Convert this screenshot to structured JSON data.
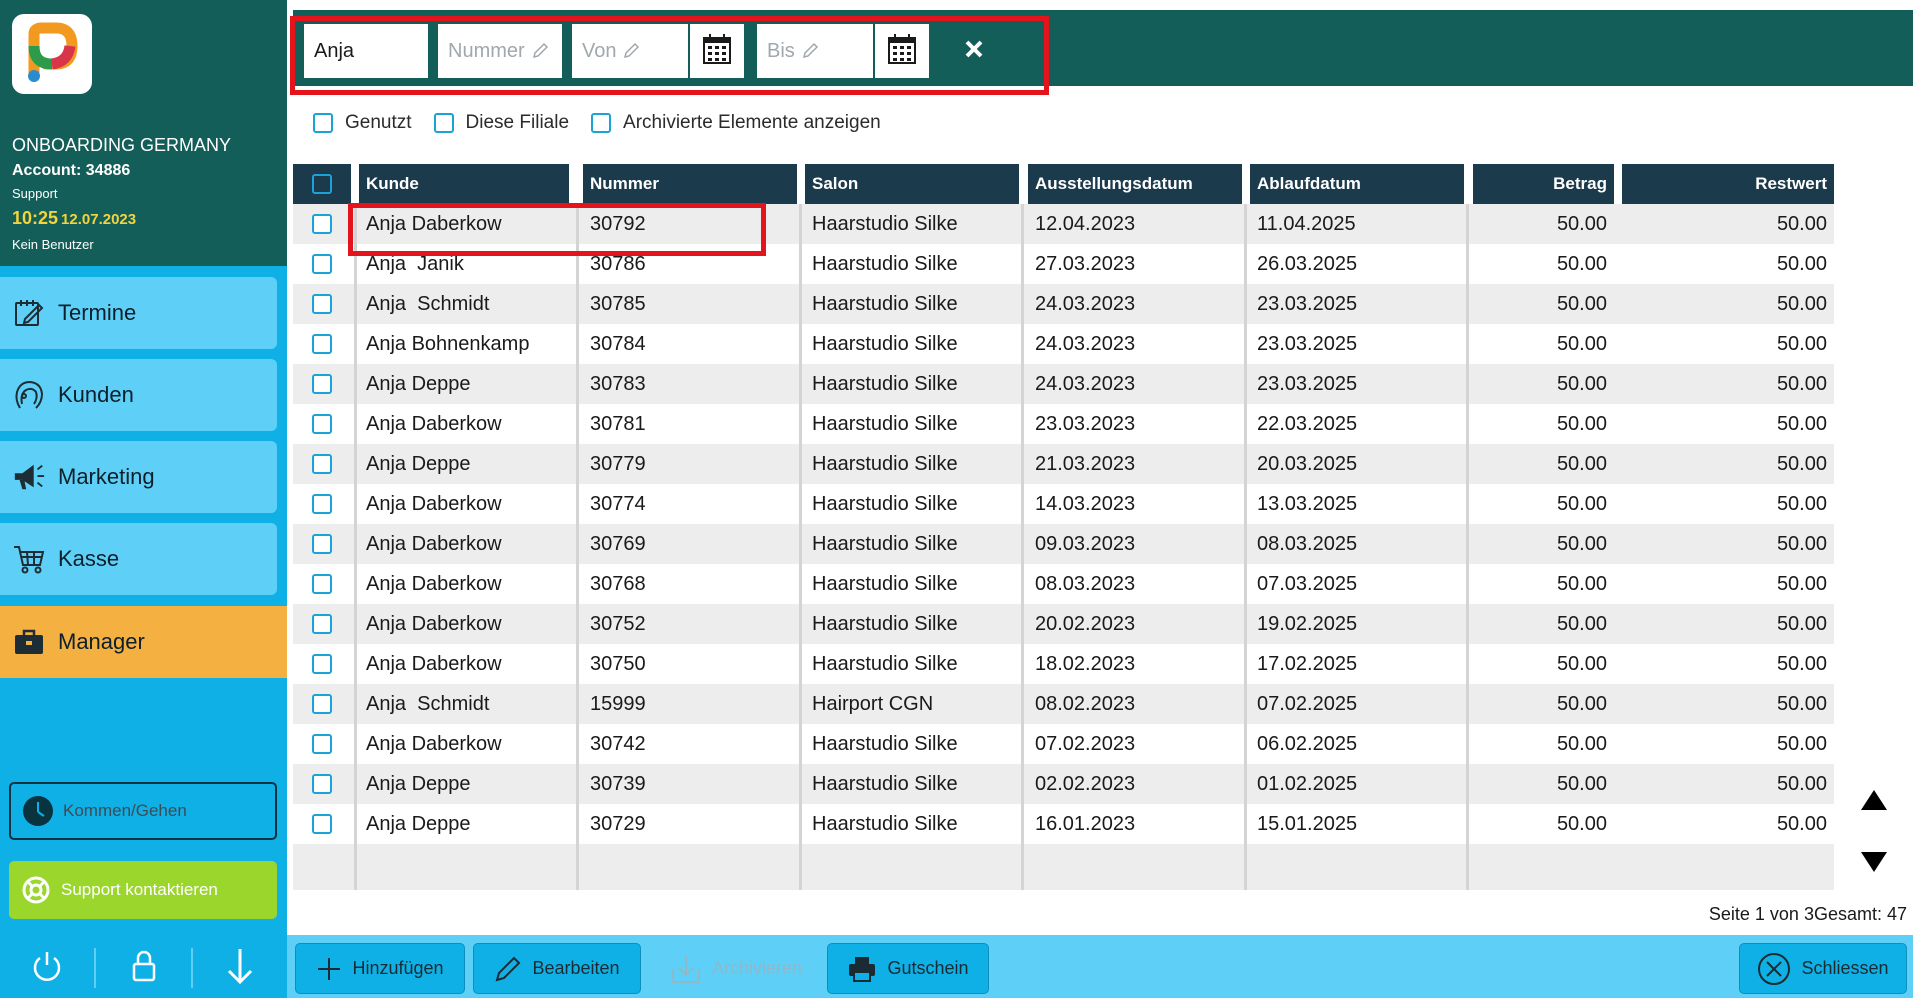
{
  "account": {
    "company": "ONBOARDING GERMANY",
    "number": "Account: 34886",
    "role": "Support",
    "time": "10:25",
    "date": "12.07.2023",
    "user": "Kein Benutzer"
  },
  "nav": [
    {
      "label": "Termine",
      "icon": "calendar-edit-icon"
    },
    {
      "label": "Kunden",
      "icon": "customer-head-icon"
    },
    {
      "label": "Marketing",
      "icon": "megaphone-icon"
    },
    {
      "label": "Kasse",
      "icon": "cart-icon"
    },
    {
      "label": "Manager",
      "icon": "briefcase-icon",
      "active": true
    }
  ],
  "side_buttons": {
    "kommen": "Kommen/Gehen",
    "support": "Support kontaktieren"
  },
  "filter": {
    "name_value": "Anja",
    "nummer_placeholder": "Nummer",
    "von_placeholder": "Von",
    "bis_placeholder": "Bis"
  },
  "checks": {
    "genutzt": "Genutzt",
    "filiale": "Diese Filiale",
    "archiviert": "Archivierte Elemente anzeigen"
  },
  "columns": {
    "kunde": "Kunde",
    "nummer": "Nummer",
    "salon": "Salon",
    "ausstellung": "Ausstellungsdatum",
    "ablauf": "Ablaufdatum",
    "betrag": "Betrag",
    "restwert": "Restwert"
  },
  "rows": [
    [
      "Anja Daberkow",
      "30792",
      "Haarstudio Silke",
      "12.04.2023",
      "11.04.2025",
      "50.00",
      "50.00"
    ],
    [
      "Anja  Janik",
      "30786",
      "Haarstudio Silke",
      "27.03.2023",
      "26.03.2025",
      "50.00",
      "50.00"
    ],
    [
      "Anja  Schmidt",
      "30785",
      "Haarstudio Silke",
      "24.03.2023",
      "23.03.2025",
      "50.00",
      "50.00"
    ],
    [
      "Anja Bohnenkamp",
      "30784",
      "Haarstudio Silke",
      "24.03.2023",
      "23.03.2025",
      "50.00",
      "50.00"
    ],
    [
      "Anja Deppe",
      "30783",
      "Haarstudio Silke",
      "24.03.2023",
      "23.03.2025",
      "50.00",
      "50.00"
    ],
    [
      "Anja Daberkow",
      "30781",
      "Haarstudio Silke",
      "23.03.2023",
      "22.03.2025",
      "50.00",
      "50.00"
    ],
    [
      "Anja Deppe",
      "30779",
      "Haarstudio Silke",
      "21.03.2023",
      "20.03.2025",
      "50.00",
      "50.00"
    ],
    [
      "Anja Daberkow",
      "30774",
      "Haarstudio Silke",
      "14.03.2023",
      "13.03.2025",
      "50.00",
      "50.00"
    ],
    [
      "Anja Daberkow",
      "30769",
      "Haarstudio Silke",
      "09.03.2023",
      "08.03.2025",
      "50.00",
      "50.00"
    ],
    [
      "Anja Daberkow",
      "30768",
      "Haarstudio Silke",
      "08.03.2023",
      "07.03.2025",
      "50.00",
      "50.00"
    ],
    [
      "Anja Daberkow",
      "30752",
      "Haarstudio Silke",
      "20.02.2023",
      "19.02.2025",
      "50.00",
      "50.00"
    ],
    [
      "Anja Daberkow",
      "30750",
      "Haarstudio Silke",
      "18.02.2023",
      "17.02.2025",
      "50.00",
      "50.00"
    ],
    [
      "Anja  Schmidt",
      "15999",
      "Hairport CGN",
      "08.02.2023",
      "07.02.2025",
      "50.00",
      "50.00"
    ],
    [
      "Anja Daberkow",
      "30742",
      "Haarstudio Silke",
      "07.02.2023",
      "06.02.2025",
      "50.00",
      "50.00"
    ],
    [
      "Anja Deppe",
      "30739",
      "Haarstudio Silke",
      "02.02.2023",
      "01.02.2025",
      "50.00",
      "50.00"
    ],
    [
      "Anja Deppe",
      "30729",
      "Haarstudio Silke",
      "16.01.2023",
      "15.01.2025",
      "50.00",
      "50.00"
    ]
  ],
  "paging": "Seite 1 von 3Gesamt: 47",
  "actions": {
    "add": "Hinzufügen",
    "edit": "Bearbeiten",
    "archive": "Archivieren",
    "voucher": "Gutschein",
    "close": "Schliessen"
  },
  "colors": {
    "header_green": "#145e59",
    "sidebar_blue": "#0fb0e6",
    "nav_blue": "#5ed0f7",
    "active_orange": "#f5b042",
    "support_green": "#9bd62d",
    "table_header": "#1b3a4b",
    "highlight_red": "#e3141b"
  }
}
